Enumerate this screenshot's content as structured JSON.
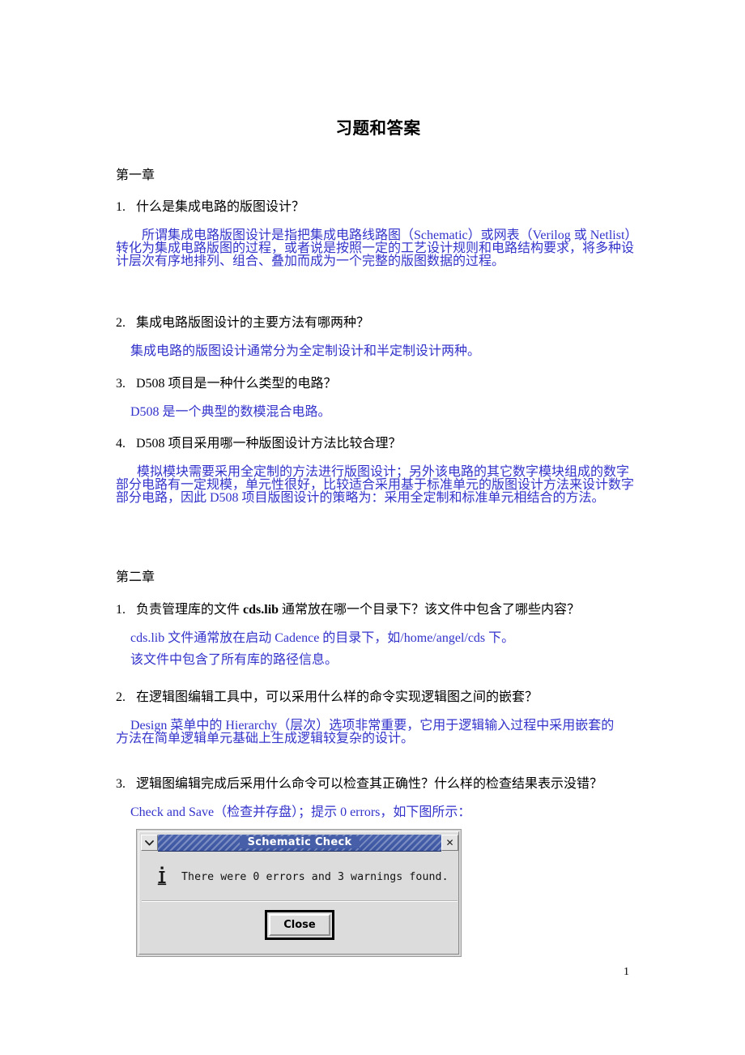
{
  "document": {
    "title": "习题和答案",
    "page_number": "1",
    "answer_color": "#3333cc"
  },
  "chapters": [
    {
      "heading": "第一章",
      "questions": [
        {
          "num": "1.",
          "text": "什么是集成电路的版图设计？",
          "answer_lines": [
            "所谓集成电路版图设计是指把集成电路线路图（Schematic）或网表（Verilog 或 Netlist）",
            "转化为集成电路版图的过程，或者说是按照一定的工艺设计规则和电路结构要求，将多种设",
            "计层次有序地排列、组合、叠加而成为一个完整的版图数据的过程。"
          ]
        },
        {
          "num": "2.",
          "text": "集成电路版图设计的主要方法有哪两种？",
          "answer_lines": [
            "集成电路的版图设计通常分为全定制设计和半定制设计两种。"
          ]
        },
        {
          "num": "3.",
          "text": "D508 项目是一种什么类型的电路？",
          "answer_lines": [
            "D508 是一个典型的数模混合电路。"
          ]
        },
        {
          "num": "4.",
          "text": "D508 项目采用哪一种版图设计方法比较合理？",
          "answer_lines": [
            "模拟模块需要采用全定制的方法进行版图设计；另外该电路的其它数字模块组成的数字",
            "部分电路有一定规模，单元性很好，比较适合采用基于标准单元的版图设计方法来设计数字",
            "部分电路，因此 D508 项目版图设计的策略为：采用全定制和标准单元相结合的方法。"
          ]
        }
      ]
    },
    {
      "heading": "第二章",
      "questions": [
        {
          "num": "1.",
          "text_prefix": "负责管理库的文件 ",
          "text_bold": "cds.lib",
          "text_suffix": " 通常放在哪一个目录下？该文件中包含了哪些内容？",
          "answer_lines": [
            "cds.lib 文件通常放在启动 Cadence 的目录下，如/home/angel/cds 下。",
            "该文件中包含了所有库的路径信息。"
          ]
        },
        {
          "num": "2.",
          "text": "在逻辑图编辑工具中，可以采用什么样的命令实现逻辑图之间的嵌套？",
          "answer_lines": [
            "Design 菜单中的 Hierarchy（层次）选项非常重要，它用于逻辑输入过程中采用嵌套的",
            "方法在简单逻辑单元基础上生成逻辑较复杂的设计。"
          ]
        },
        {
          "num": "3.",
          "text": "逻辑图编辑完成后采用什么命令可以检查其正确性？什么样的检查结果表示没错？",
          "answer_lines": [
            "Check and Save（检查并存盘）；提示 0 errors，如下图所示："
          ]
        }
      ]
    }
  ],
  "dialog": {
    "title": "Schematic Check",
    "menu_icon": "chevron-down-icon",
    "close_icon": "close-icon",
    "info_icon": "info-icon",
    "message": "There were 0 errors and 3 warnings found.",
    "button_label": "Close"
  }
}
